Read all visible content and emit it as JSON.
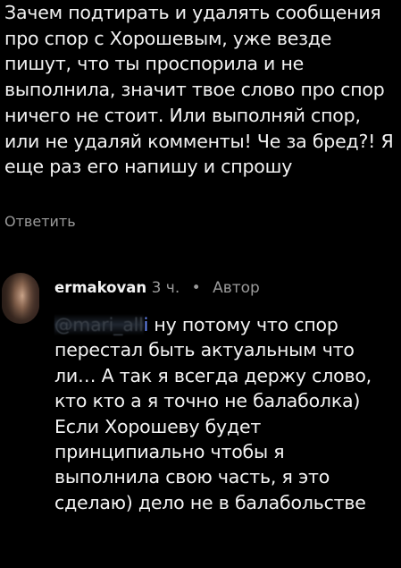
{
  "parent_comment": {
    "text": "Зачем подтирать и удалять сообщения про спор с Хорошевым, уже везде пишут, что ты проспорила и не выполнила, значит твое слово про спор ничего не стоит. Или выполняй спор, или не удаляй комменты! Че за бред?! Я еще раз его напишу и спрошу",
    "reply_label": "Ответить"
  },
  "reply": {
    "username": "ermakovan",
    "time": "3 ч.",
    "separator": "•",
    "author_badge": "Автор",
    "mention": "@mari_all",
    "mention_tail": "i",
    "text": " ну потому что спор перестал быть актуальным что ли… А так я всегда держу слово, кто кто а я точно не балаболка) Если Хорошеву будет принципиально чтобы я выполнила свою часть, я это сделаю) дело не в балабольстве"
  }
}
